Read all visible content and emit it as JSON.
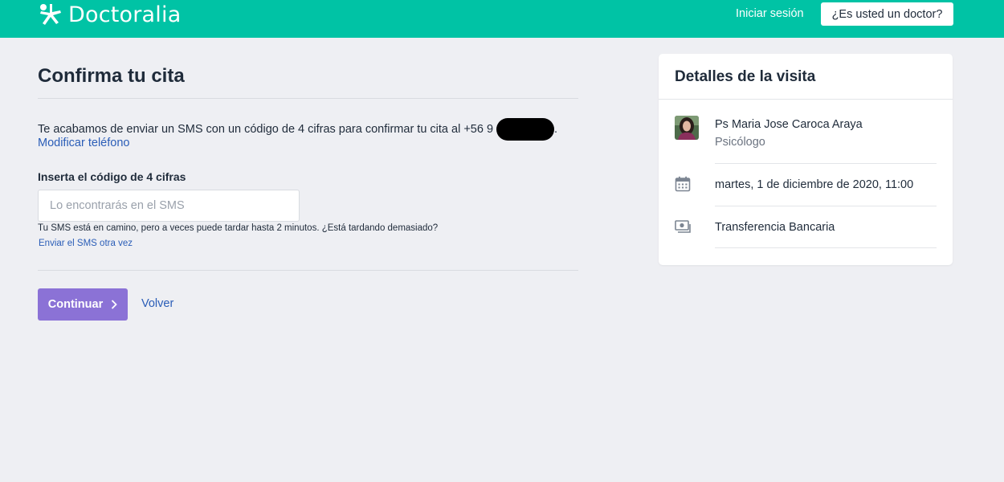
{
  "header": {
    "brand": "Doctoralia",
    "login_label": "Iniciar sesión",
    "doctor_button": "¿Es usted un doctor?",
    "brand_color": "#00c3a5"
  },
  "main": {
    "title": "Confirma tu cita",
    "sms_message": "Te acabamos de enviar un SMS con un código de 4 cifras para confirmar tu cita al +56 9",
    "sms_message_end": ".",
    "modify_phone_link": "Modificar teléfono",
    "code_label": "Inserta el código de 4 cifras",
    "code_placeholder": "Lo encontrarás en el SMS",
    "code_value": "",
    "hint": "Tu SMS está en camino, pero a veces puede tardar hasta 2 minutos. ¿Está tardando demasiado?",
    "resend_link": "Enviar el SMS otra vez",
    "continue_button": "Continuar",
    "back_link": "Volver",
    "accent_color": "#8b72d6",
    "link_color": "#2a5db7"
  },
  "visit": {
    "title": "Detalles de la visita",
    "doctor_name": "Ps Maria Jose Caroca Araya",
    "doctor_specialty": "Psicólogo",
    "datetime": "martes, 1 de diciembre de 2020, 11:00",
    "payment": "Transferencia Bancaria"
  },
  "icons": [
    "doctoralia-logo-icon",
    "calendar-icon",
    "money-icon",
    "chevron-right-icon"
  ]
}
